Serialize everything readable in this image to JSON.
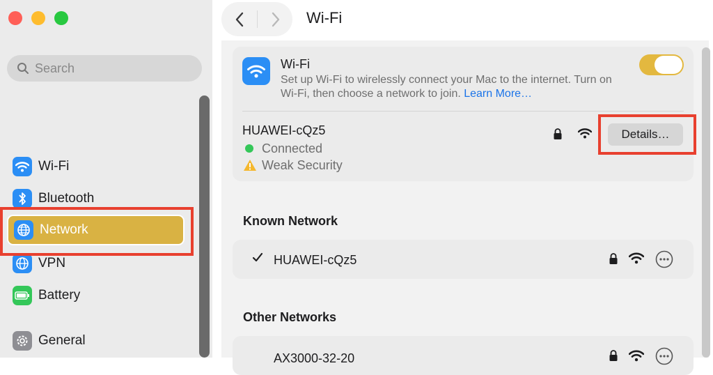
{
  "window": {
    "title": "Wi-Fi"
  },
  "sidebar": {
    "search_placeholder": "Search",
    "items": [
      {
        "label": "Wi-Fi",
        "icon": "wifi-icon",
        "color": "#2b8ef5"
      },
      {
        "label": "Bluetooth",
        "icon": "bluetooth-icon",
        "color": "#2b8ef5"
      },
      {
        "label": "Network",
        "icon": "globe-icon",
        "color": "#2b8ef5",
        "selected": true
      },
      {
        "label": "VPN",
        "icon": "globe-icon",
        "color": "#2b8ef5"
      },
      {
        "label": "Battery",
        "icon": "battery-icon",
        "color": "#34c759"
      },
      {
        "label": "General",
        "icon": "gear-icon",
        "color": "#8e8e93"
      }
    ]
  },
  "wifi_card": {
    "title": "Wi-Fi",
    "description": "Set up Wi-Fi to wirelessly connect your Mac to the internet. Turn on Wi-Fi, then choose a network to join.",
    "learn_more": "Learn More…",
    "toggle_on": true
  },
  "current_network": {
    "name": "HUAWEI-cQz5",
    "status": "Connected",
    "warning": "Weak Security",
    "details_label": "Details…"
  },
  "known_networks": {
    "heading": "Known Network",
    "items": [
      {
        "name": "HUAWEI-cQz5",
        "checked": true
      }
    ]
  },
  "other_networks": {
    "heading": "Other Networks",
    "items": [
      {
        "name": "AX3000-32-20"
      }
    ]
  },
  "colors": {
    "accent": "#d9b243",
    "highlight_box": "#e8402f",
    "link": "#1a73e8",
    "connected": "#34c759"
  }
}
